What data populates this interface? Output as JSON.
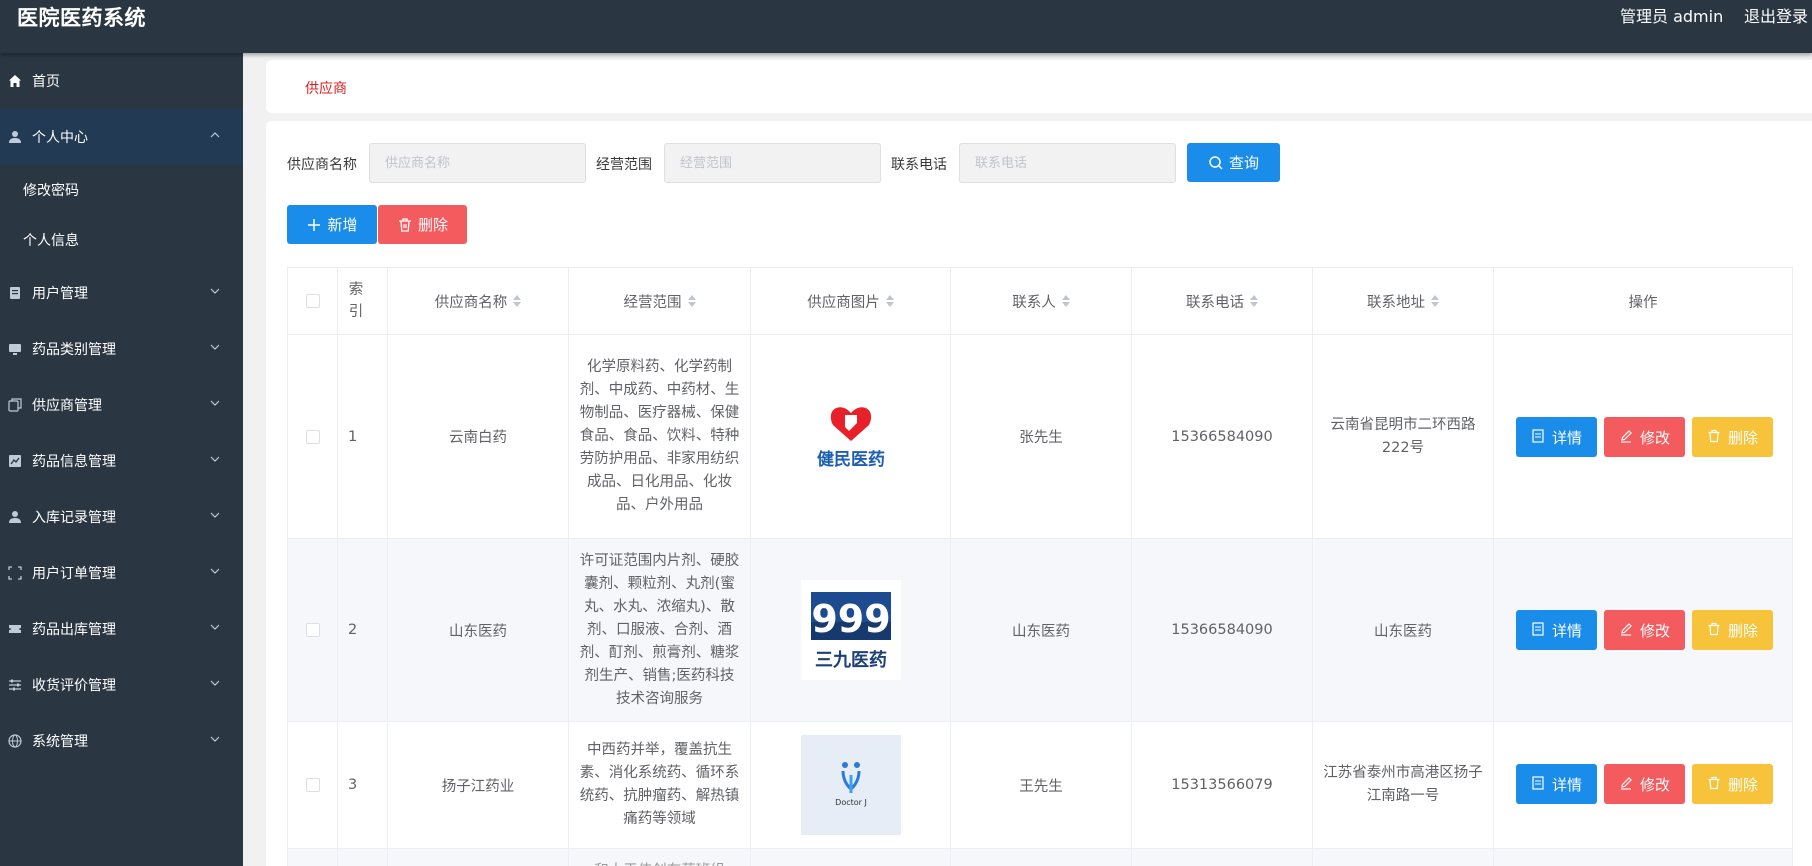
{
  "header": {
    "app_title": "医院医药系统",
    "admin_label": "管理员 admin",
    "logout": "退出登录"
  },
  "sidebar": {
    "items": [
      {
        "label": "首页",
        "icon": "home-icon"
      },
      {
        "label": "个人中心",
        "icon": "user-icon",
        "expanded": true,
        "children": [
          {
            "label": "修改密码"
          },
          {
            "label": "个人信息"
          }
        ]
      },
      {
        "label": "用户管理",
        "icon": "document-icon"
      },
      {
        "label": "药品类别管理",
        "icon": "monitor-icon"
      },
      {
        "label": "供应商管理",
        "icon": "copy-icon"
      },
      {
        "label": "药品信息管理",
        "icon": "chart-icon"
      },
      {
        "label": "入库记录管理",
        "icon": "user-icon"
      },
      {
        "label": "用户订单管理",
        "icon": "fullscreen-icon"
      },
      {
        "label": "药品出库管理",
        "icon": "ticket-icon"
      },
      {
        "label": "收货评价管理",
        "icon": "sliders-icon"
      },
      {
        "label": "系统管理",
        "icon": "globe-icon"
      }
    ]
  },
  "breadcrumb": "供应商",
  "search": {
    "fields": [
      {
        "label": "供应商名称",
        "placeholder": "供应商名称"
      },
      {
        "label": "经营范围",
        "placeholder": "经营范围"
      },
      {
        "label": "联系电话",
        "placeholder": "联系电话"
      }
    ],
    "query_button": "查询"
  },
  "actions": {
    "add_button": "新增",
    "delete_button": "删除"
  },
  "table": {
    "columns": [
      "索引",
      "供应商名称",
      "经营范围",
      "供应商图片",
      "联系人",
      "联系电话",
      "联系地址",
      "操作"
    ],
    "rows": [
      {
        "index": "1",
        "name": "云南白药",
        "scope": "化学原料药、化学药制剂、中成药、中药材、生物制品、医疗器械、保健食品、食品、饮料、特种劳防护用品、非家用纺织成品、日化用品、化妆品、户外用品",
        "image_text": "健民医药",
        "contact": "张先生",
        "phone": "15366584090",
        "address": "云南省昆明市二环西路222号"
      },
      {
        "index": "2",
        "name": "山东医药",
        "scope": "许可证范围内片剂、硬胶囊剂、颗粒剂、丸剂(蜜丸、水丸、浓缩丸)、散剂、口服液、合剂、酒剂、酊剂、煎膏剂、糖浆剂生产、销售;医药科技技术咨询服务",
        "image_text": "三九医药",
        "image_brand": "999",
        "contact": "山东医药",
        "phone": "15366584090",
        "address": "山东医药"
      },
      {
        "index": "3",
        "name": "扬子江药业",
        "scope": "中西药并举，覆盖抗生素、消化系统药、循环系统药、抗肿瘤药、解热镇痛药等领域",
        "image_text": "Doctor J",
        "contact": "王先生",
        "phone": "15313566079",
        "address": "江苏省泰州市高港区扬子江南路一号"
      }
    ],
    "partial_next_row_text": "和大于伟创在药班组"
  },
  "row_buttons": {
    "detail": "详情",
    "edit": "修改",
    "delete": "删除"
  },
  "colors": {
    "header_bg": "#2b3643",
    "primary": "#1a8dea",
    "danger": "#f35b5e",
    "warning": "#f6c33b",
    "breadcrumb": "#e02020"
  }
}
